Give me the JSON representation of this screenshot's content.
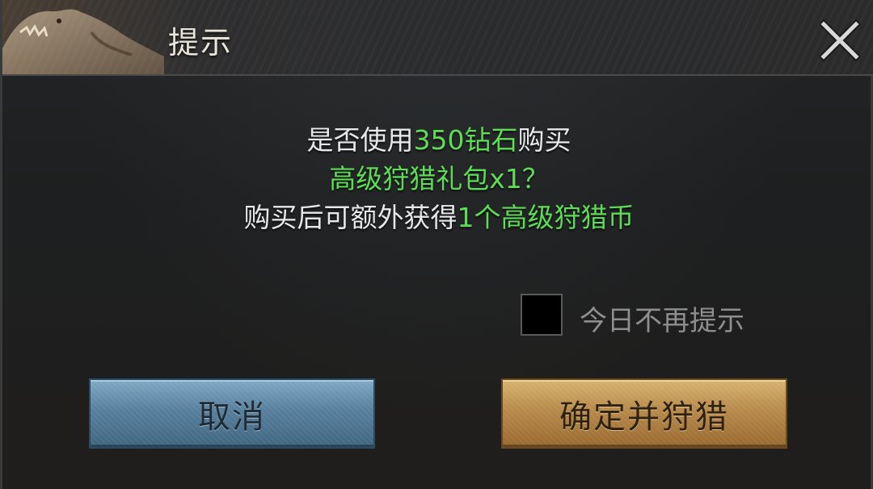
{
  "dialog": {
    "title": "提示",
    "message": {
      "line1_prefix": "是否使用",
      "line1_highlight": "350钻石",
      "line1_suffix": "购买",
      "line2_highlight": "高级狩猎礼包x1？",
      "line3_prefix": "购买后可额外获得",
      "line3_highlight": "1个高级狩猎币"
    },
    "dont_show_today_label": "今日不再提示",
    "dont_show_today_checked": false,
    "cancel_label": "取消",
    "confirm_label": "确定并狩猎"
  },
  "icons": {
    "close": "close-icon",
    "header_art": "dinosaur-art"
  },
  "colors": {
    "highlight": "#5fdc57",
    "text": "#e8e8e8",
    "cancel_button": "#5f88a5",
    "confirm_button": "#c09350"
  }
}
